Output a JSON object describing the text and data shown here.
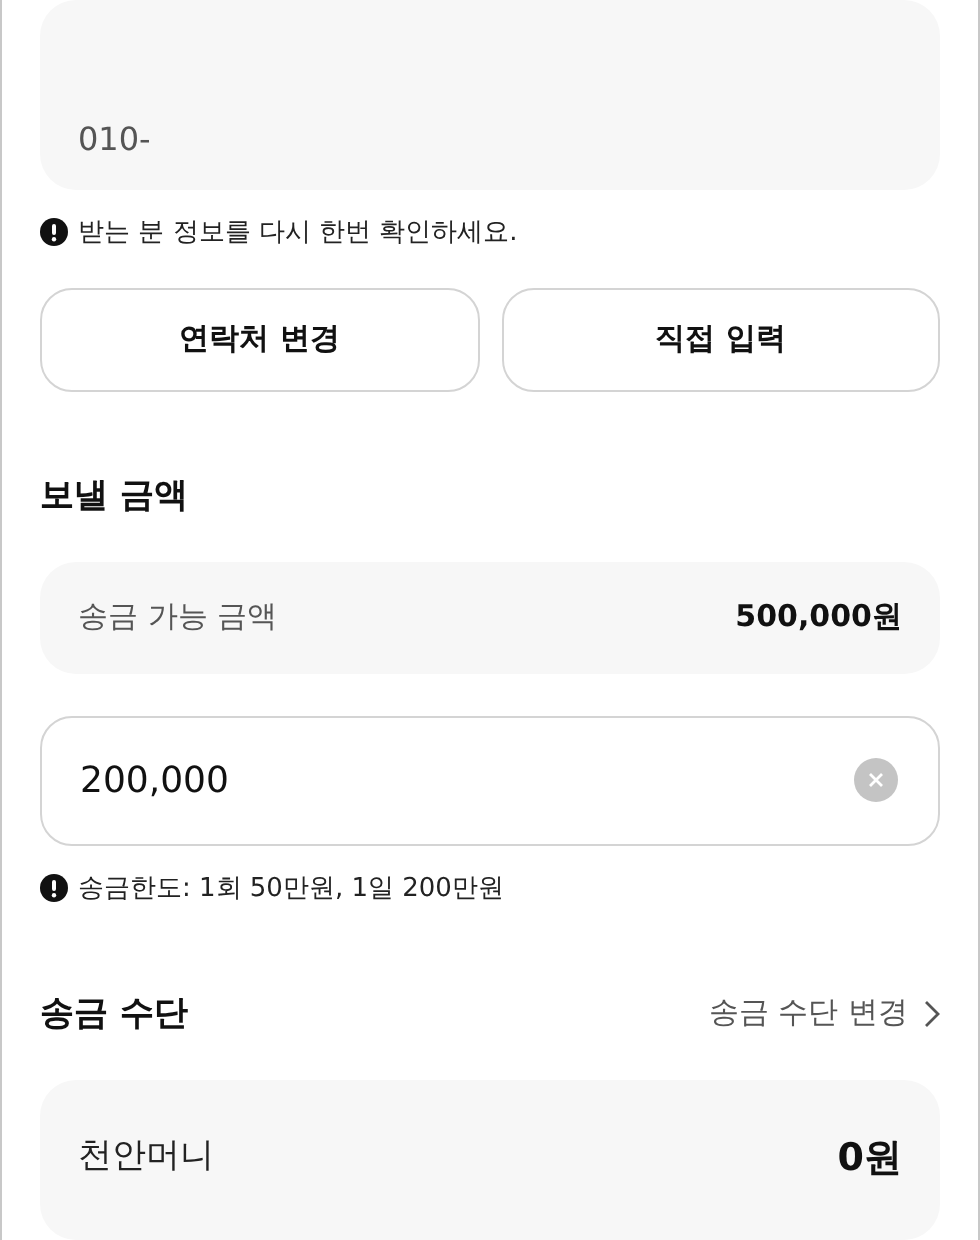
{
  "phone_field": {
    "value": "010-"
  },
  "recipient_notice": "받는 분 정보를 다시 한번 확인하세요.",
  "buttons": [
    "연락처 변경",
    "직접 입력"
  ],
  "amount_section": {
    "title": "보낼 금액",
    "available": {
      "label": "송금 가능 금액",
      "value": "500,000원"
    },
    "amount_field": {
      "value": "200,000"
    },
    "limit_notice": "송금한도: 1회 50만원, 1일 200만원"
  },
  "method_section": {
    "title": "송금 수단",
    "change_link": "송금 수단 변경",
    "method": {
      "name": "천안머니",
      "balance": "0원"
    }
  }
}
